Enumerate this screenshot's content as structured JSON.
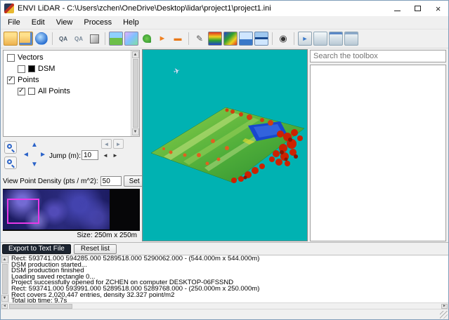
{
  "window": {
    "title": "ENVI LiDAR - C:\\Users\\zchen\\OneDrive\\Desktop\\lidar\\project1\\project1.ini"
  },
  "menu": {
    "items": [
      "File",
      "Edit",
      "View",
      "Process",
      "Help"
    ]
  },
  "toolbar": {
    "icons": [
      "open-project",
      "save-project",
      "globe-zoom",
      "separator",
      "qa-quality-1",
      "qa-quality-2",
      "cube-3d",
      "separator",
      "ortho-image",
      "raster-image",
      "vegetation-classify",
      "flightline-arrow",
      "section-line",
      "separator",
      "edit-tool",
      "elevation-colormap",
      "terrain-colormap",
      "profile-view",
      "cross-section-view",
      "separator",
      "eye-visibility",
      "separator",
      "export-display",
      "display-window-1",
      "display-window-2",
      "display-window-3"
    ]
  },
  "layers": {
    "items": [
      {
        "label": "Vectors",
        "checked": false,
        "swatch": null
      },
      {
        "label": "DSM",
        "checked": false,
        "swatch": "#000000"
      },
      {
        "label": "Points",
        "checked": true,
        "swatch": null
      },
      {
        "label": "All Points",
        "checked": true,
        "swatch": "#ffffff"
      }
    ]
  },
  "navigation": {
    "jump_label": "Jump (m):",
    "jump_value": "10"
  },
  "density": {
    "label": "View Point Density (pts / m^2):",
    "value": "50",
    "set_button": "Set"
  },
  "preview": {
    "size_label": "Size: 250m x 250m"
  },
  "toolbox": {
    "search_placeholder": "Search the toolbox"
  },
  "log": {
    "export_button": "Export to Text File",
    "reset_button": "Reset list",
    "lines": [
      "Rect: 593741.000 594285.000 5289518.000 5290062.000 - (544.000m x 544.000m)",
      "DSM production started...",
      "DSM production finished",
      "Loading saved rectangle 0...",
      "Project successfully opened for ZCHEN on computer DESKTOP-06FSSND",
      "Rect: 593741.000 593991.000 5289518.000 5289768.000 - (250.000m x 250.000m)",
      "Rect covers 2,020,447 entries, density 32.327 point/m2",
      "Total job time:  9.7s"
    ]
  },
  "colors": {
    "view_background": "#00b2b2",
    "selection_rect": "#e838e8",
    "terrain_green": "#4fae3a",
    "tree_red": "#cc2200",
    "water_blue": "#1848cc"
  }
}
